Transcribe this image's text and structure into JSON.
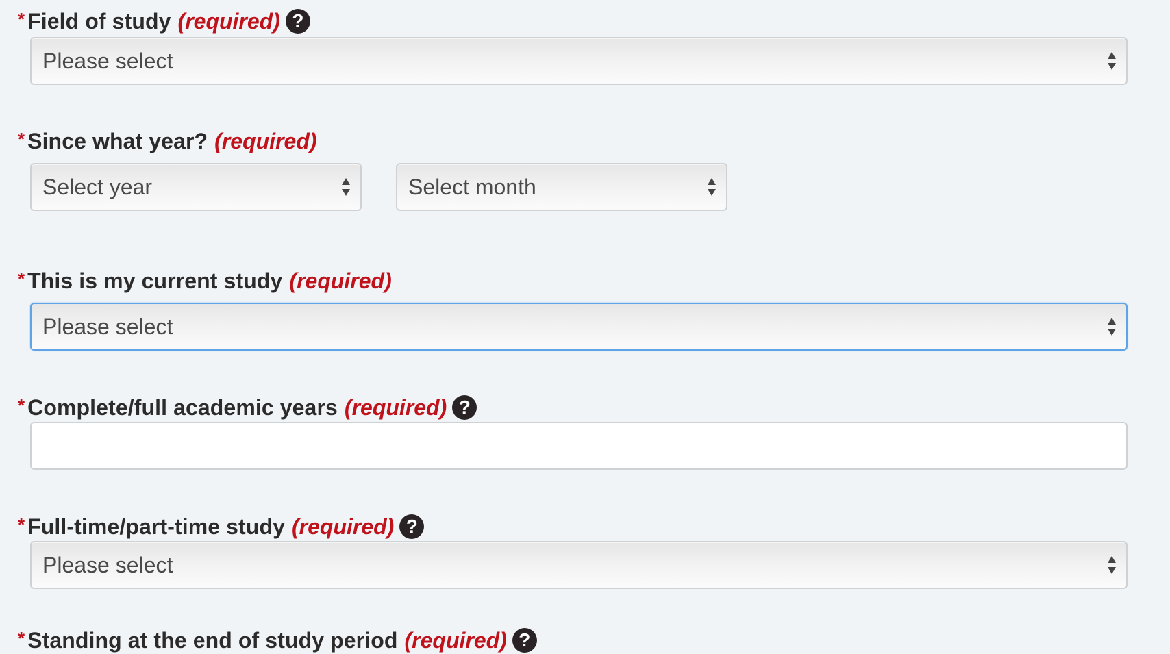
{
  "form": {
    "required_marker": "*",
    "required_tag": "(required)",
    "help_symbol": "?",
    "fields": [
      {
        "label": "Field of study",
        "has_help": true,
        "control": "select",
        "value": "Please select"
      },
      {
        "label": "Since what year?",
        "has_help": false,
        "control": "select-pair",
        "year_value": "Select year",
        "month_value": "Select month"
      },
      {
        "label": "This is my current study",
        "has_help": false,
        "control": "select",
        "value": "Please select",
        "focused": true
      },
      {
        "label": "Complete/full academic years",
        "has_help": true,
        "control": "text",
        "value": ""
      },
      {
        "label": "Full-time/part-time study",
        "has_help": true,
        "control": "select",
        "value": "Please select"
      },
      {
        "label": "Standing at the end of study period",
        "has_help": true,
        "control": "select",
        "value": ""
      }
    ]
  },
  "colors": {
    "background": "#f1f4f7",
    "required_red": "#c0121b",
    "label_text": "#2b2b2b",
    "focus_blue": "#5ea4e6",
    "help_icon_bg": "#2a2326"
  },
  "icons": {
    "help": "question-circle-icon",
    "select_arrows": "sort-arrows-icon"
  }
}
